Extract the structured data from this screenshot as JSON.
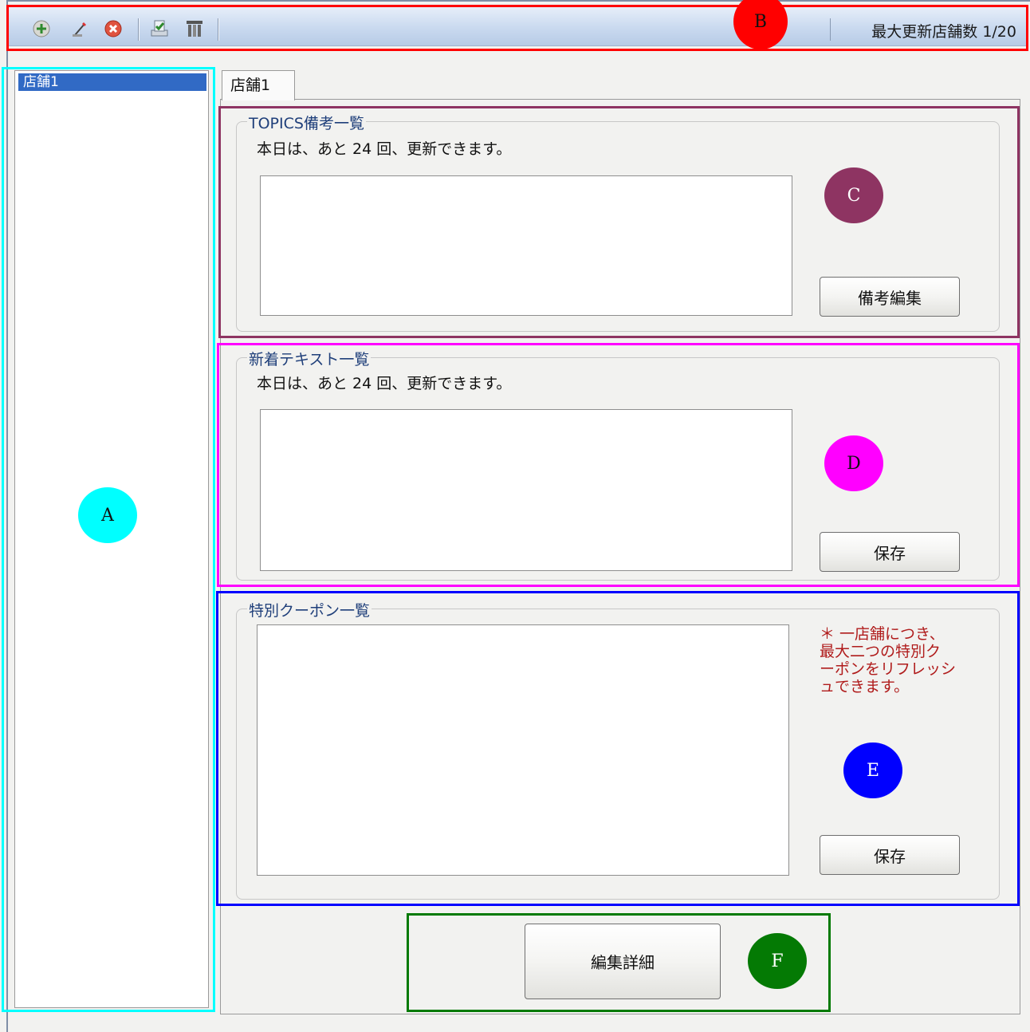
{
  "toolbar": {
    "icons": [
      "add-icon",
      "edit-icon",
      "delete-icon",
      "update-icon",
      "settings-icon"
    ],
    "status_text": "最大更新店舗数 1/20"
  },
  "store_list": {
    "items": [
      {
        "label": "店舗1",
        "selected": true
      }
    ]
  },
  "tabs": [
    {
      "label": "店舗1",
      "active": true
    }
  ],
  "topics": {
    "title": "TOPICS備考一覧",
    "info": "本日は、あと 24 回、更新できます。",
    "text_value": "",
    "edit_button": "備考編集"
  },
  "new_text": {
    "title": "新着テキスト一覧",
    "info": "本日は、あと 24 回、更新できます。",
    "text_value": "",
    "save_button": "保存"
  },
  "coupon": {
    "title": "特別クーポン一覧",
    "text_value": "",
    "note_lines": [
      "＊ 一店舗につき、",
      "最大二つの特別ク",
      "ーポンをリフレッシ",
      "ュできます。"
    ],
    "save_button": "保存"
  },
  "detail_button": "編集詳細",
  "annotations": {
    "markers": [
      "A",
      "B",
      "C",
      "D",
      "E",
      "F"
    ],
    "colors": {
      "A": "#00ffff",
      "B": "#ff0000",
      "C": "#8e3462",
      "D": "#ff00ff",
      "E": "#0000ff",
      "F": "#047a04"
    }
  }
}
